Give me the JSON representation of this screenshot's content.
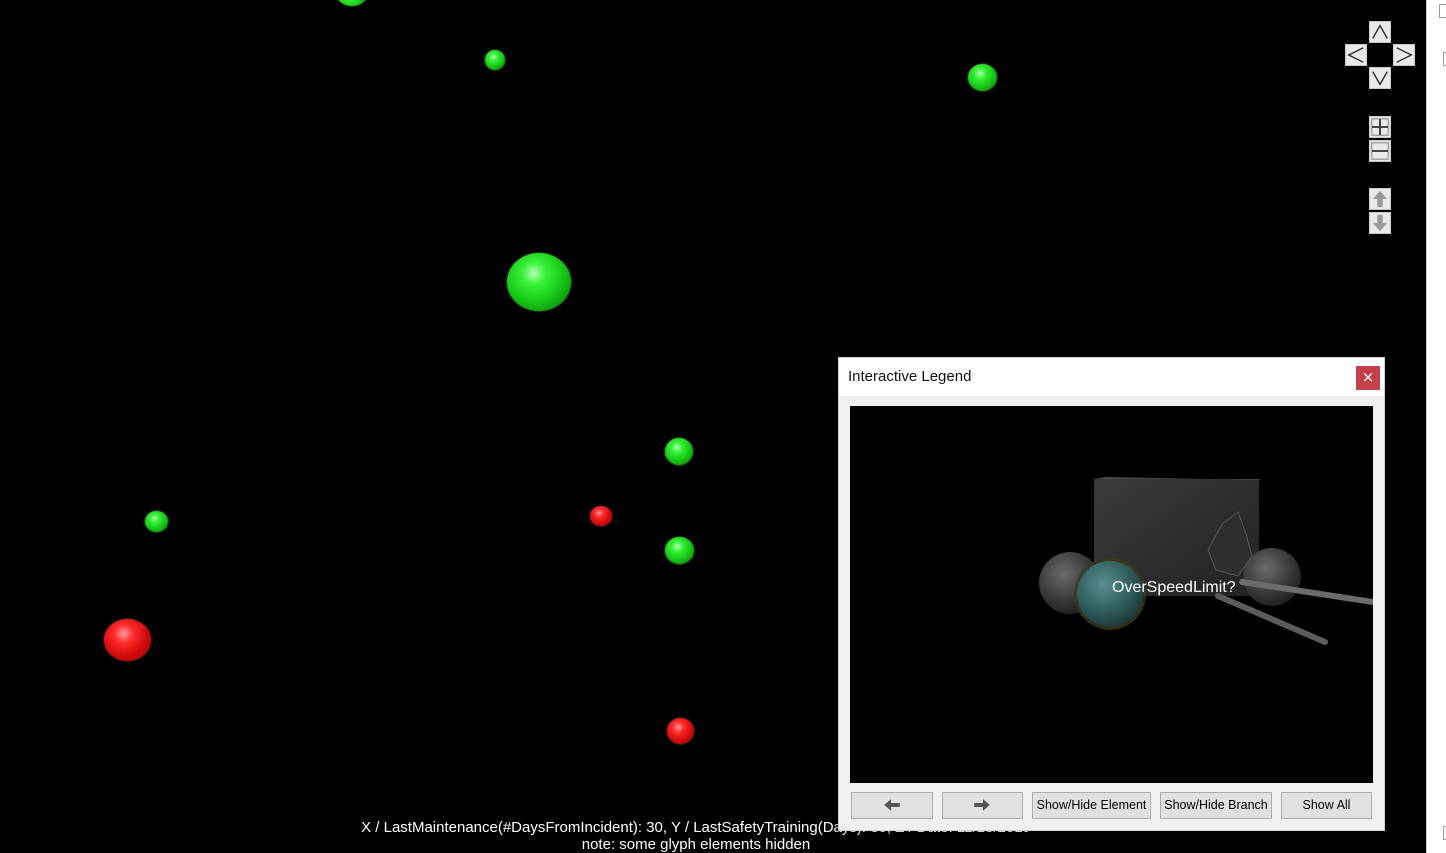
{
  "scene": {
    "green_color": "#22dd22",
    "red_color": "#dd1111",
    "glyphs": [
      {
        "kind": "green-sphere"
      },
      {
        "kind": "green-sphere"
      },
      {
        "kind": "green-sphere"
      },
      {
        "kind": "green-sphere"
      },
      {
        "kind": "green-sphere"
      },
      {
        "kind": "green-sphere"
      },
      {
        "kind": "green-sphere"
      },
      {
        "kind": "red-sphere"
      },
      {
        "kind": "red-sphere"
      },
      {
        "kind": "red-sphere"
      }
    ]
  },
  "caption": {
    "axes": "X / LastMaintenance(#DaysFromIncident): 30, Y / LastSafetyTraining(Days): 30, Z / Date: 11/13/2019",
    "note": "note: some glyph elements hidden"
  },
  "navigation": {
    "icons": [
      "pan-up-icon",
      "pan-left-icon",
      "pan-right-icon",
      "pan-down-icon",
      "zoom-in-icon",
      "zoom-out-icon",
      "move-up-icon",
      "move-down-icon"
    ]
  },
  "legend": {
    "title": "Interactive Legend",
    "close_label": "×",
    "glyph_label": "OverSpeedLimit?",
    "buttons": {
      "back_icon": "arrow-left-icon",
      "forward_icon": "arrow-right-icon",
      "show_hide_element": "Show/Hide Element",
      "show_hide_branch": "Show/Hide Branch",
      "show_all": "Show All"
    }
  }
}
